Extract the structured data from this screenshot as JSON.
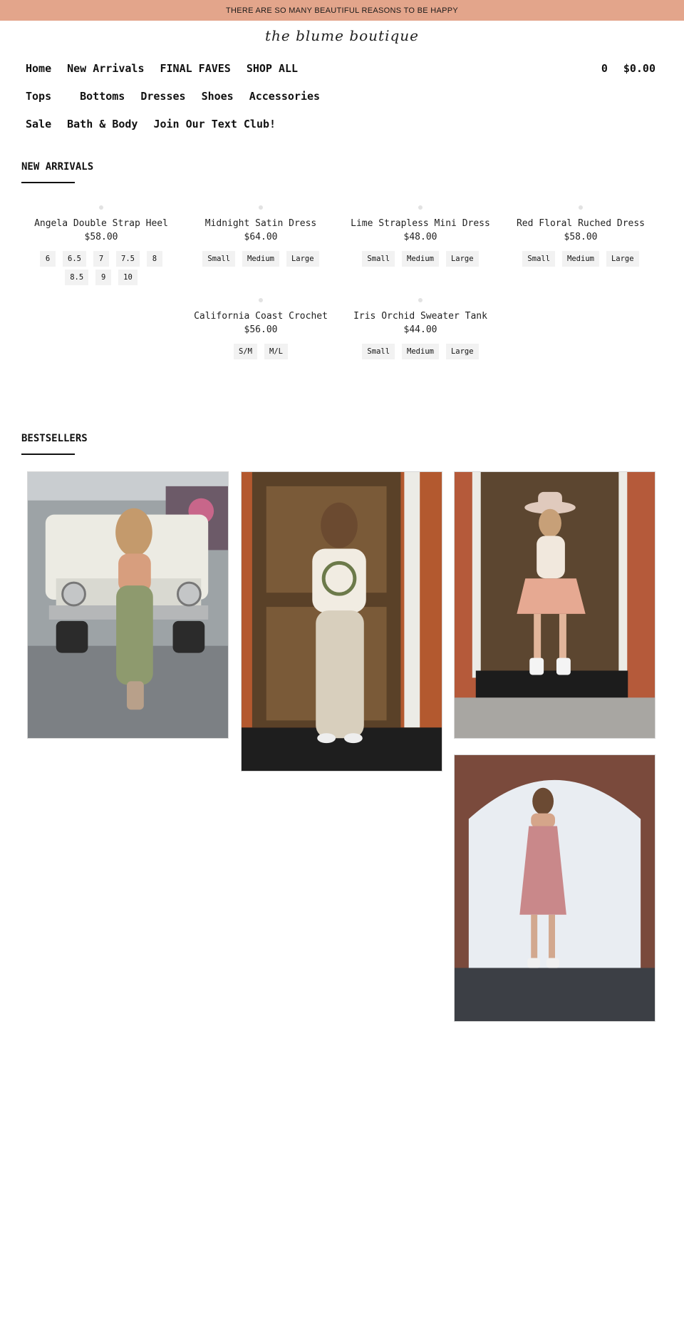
{
  "announcement": "THERE ARE SO MANY BEAUTIFUL REASONS TO BE HAPPY",
  "logo": "the blume boutique",
  "nav": {
    "row1": [
      "Home",
      "New Arrivals",
      "FINAL FAVES",
      "SHOP ALL"
    ],
    "row2": [
      "Tops",
      "Bottoms",
      "Dresses",
      "Shoes",
      "Accessories"
    ],
    "row3": [
      "Sale",
      "Bath & Body",
      "Join Our Text Club!"
    ]
  },
  "cart": {
    "count": "0",
    "total": "$0.00"
  },
  "new_arrivals": {
    "title": "NEW ARRIVALS",
    "products": [
      {
        "name": "Angela Double Strap Heel",
        "price": "$58.00",
        "sizes": [
          "6",
          "6.5",
          "7",
          "7.5",
          "8",
          "8.5",
          "9",
          "10"
        ]
      },
      {
        "name": "Midnight Satin Dress",
        "price": "$64.00",
        "sizes": [
          "Small",
          "Medium",
          "Large"
        ]
      },
      {
        "name": "Lime Strapless Mini Dress",
        "price": "$48.00",
        "sizes": [
          "Small",
          "Medium",
          "Large"
        ]
      },
      {
        "name": "Red Floral Ruched Dress",
        "price": "$58.00",
        "sizes": [
          "Small",
          "Medium",
          "Large"
        ]
      },
      {
        "name": "California Coast Crochet",
        "price": "$56.00",
        "sizes": [
          "S/M",
          "M/L"
        ]
      },
      {
        "name": "Iris Orchid Sweater Tank",
        "price": "$44.00",
        "sizes": [
          "Small",
          "Medium",
          "Large"
        ]
      }
    ]
  },
  "bestsellers": {
    "title": "BESTSELLERS"
  },
  "colors": {
    "announcement_bg": "#e3a58b",
    "size_chip_bg": "#f2f2f2",
    "text": "#111111"
  }
}
